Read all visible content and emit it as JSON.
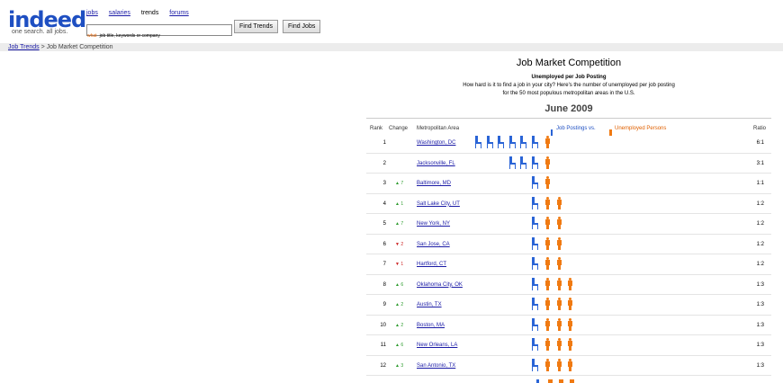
{
  "logo": {
    "word": "indeed",
    "tagline": "one search. all jobs."
  },
  "nav": {
    "items": [
      {
        "label": "jobs",
        "link": true
      },
      {
        "label": "salaries",
        "link": true
      },
      {
        "label": "trends",
        "link": false
      },
      {
        "label": "forums",
        "link": true
      }
    ]
  },
  "search": {
    "value": "",
    "hint_what": "what",
    "hint_text": "job title, keywords or company"
  },
  "buttons": {
    "find_trends": "Find Trends",
    "find_jobs": "Find Jobs"
  },
  "breadcrumb": {
    "link": "Job Trends",
    "sep": " > ",
    "current": "Job Market Competition"
  },
  "panel": {
    "title": "Job Market Competition",
    "sub_heading": "Unemployed per Job Posting",
    "sub_line1": "How hard is it to find a job in your city? Here's the number of unemployed per job posting",
    "sub_line2": "for the 50 most populous metropolitan areas in the U.S.",
    "month": "June 2009"
  },
  "table": {
    "headers": {
      "rank": "Rank",
      "change": "Change",
      "area": "Metropolitan Area",
      "legend_jobs": "Job Postings vs.",
      "legend_unemployed": "Unemployed Persons",
      "ratio": "Ratio"
    },
    "colors": {
      "job": "#2a64d6",
      "person": "#f07a12"
    },
    "rows": [
      {
        "rank": "1",
        "change": "",
        "dir": "",
        "city": "Washington, DC",
        "chairs": 6,
        "persons": 1,
        "ratio": "6:1"
      },
      {
        "rank": "2",
        "change": "",
        "dir": "",
        "city": "Jacksonville, FL",
        "chairs": 3,
        "persons": 1,
        "ratio": "3:1"
      },
      {
        "rank": "3",
        "change": "▲ 7",
        "dir": "up",
        "city": "Baltimore, MD",
        "chairs": 1,
        "persons": 1,
        "ratio": "1:1"
      },
      {
        "rank": "4",
        "change": "▲ 1",
        "dir": "up",
        "city": "Salt Lake City, UT",
        "chairs": 1,
        "persons": 2,
        "ratio": "1:2"
      },
      {
        "rank": "5",
        "change": "▲ 7",
        "dir": "up",
        "city": "New York, NY",
        "chairs": 1,
        "persons": 2,
        "ratio": "1:2"
      },
      {
        "rank": "6",
        "change": "▼ 2",
        "dir": "dn",
        "city": "San Jose, CA",
        "chairs": 1,
        "persons": 2,
        "ratio": "1:2"
      },
      {
        "rank": "7",
        "change": "▼ 1",
        "dir": "dn",
        "city": "Hartford, CT",
        "chairs": 1,
        "persons": 2,
        "ratio": "1:2"
      },
      {
        "rank": "8",
        "change": "▲ 6",
        "dir": "up",
        "city": "Oklahoma City, OK",
        "chairs": 1,
        "persons": 3,
        "ratio": "1:3"
      },
      {
        "rank": "9",
        "change": "▲ 2",
        "dir": "up",
        "city": "Austin, TX",
        "chairs": 1,
        "persons": 3,
        "ratio": "1:3"
      },
      {
        "rank": "10",
        "change": "▲ 2",
        "dir": "up",
        "city": "Boston, MA",
        "chairs": 1,
        "persons": 3,
        "ratio": "1:3"
      },
      {
        "rank": "11",
        "change": "▲ 6",
        "dir": "up",
        "city": "New Orleans, LA",
        "chairs": 1,
        "persons": 3,
        "ratio": "1:3"
      },
      {
        "rank": "12",
        "change": "▲ 3",
        "dir": "up",
        "city": "San Antonio, TX",
        "chairs": 1,
        "persons": 3,
        "ratio": "1:3"
      }
    ]
  }
}
